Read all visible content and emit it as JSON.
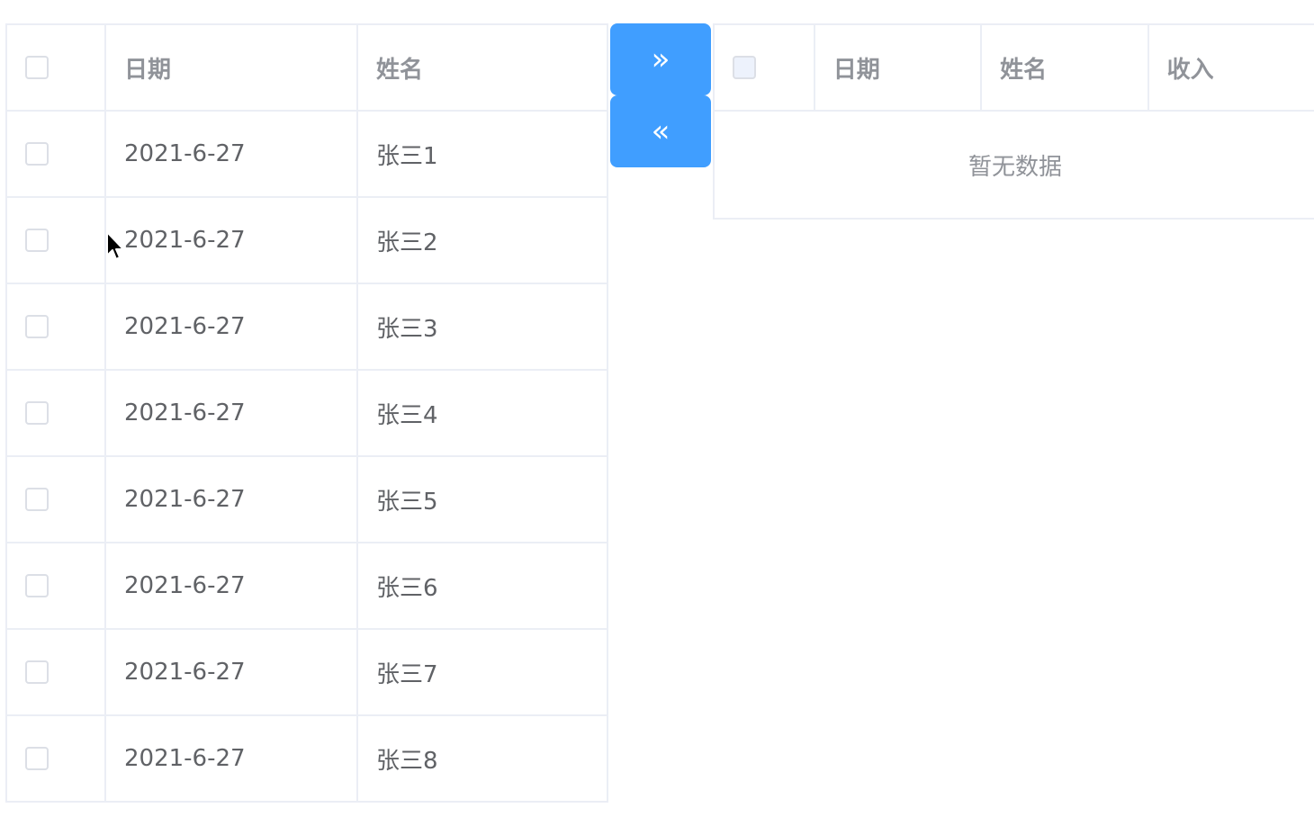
{
  "left_table": {
    "headers": {
      "date": "日期",
      "name": "姓名"
    },
    "rows": [
      {
        "date": "2021-6-27",
        "name": "张三1"
      },
      {
        "date": "2021-6-27",
        "name": "张三2"
      },
      {
        "date": "2021-6-27",
        "name": "张三3"
      },
      {
        "date": "2021-6-27",
        "name": "张三4"
      },
      {
        "date": "2021-6-27",
        "name": "张三5"
      },
      {
        "date": "2021-6-27",
        "name": "张三6"
      },
      {
        "date": "2021-6-27",
        "name": "张三7"
      },
      {
        "date": "2021-6-27",
        "name": "张三8"
      }
    ]
  },
  "transfer": {
    "move_right_icon": "»",
    "move_left_icon": "«"
  },
  "right_table": {
    "headers": {
      "date": "日期",
      "name": "姓名",
      "income": "收入"
    },
    "empty_text": "暂无数据"
  },
  "colors": {
    "primary": "#409eff",
    "border": "#ebeef5",
    "header_text": "#909399",
    "body_text": "#606266"
  }
}
